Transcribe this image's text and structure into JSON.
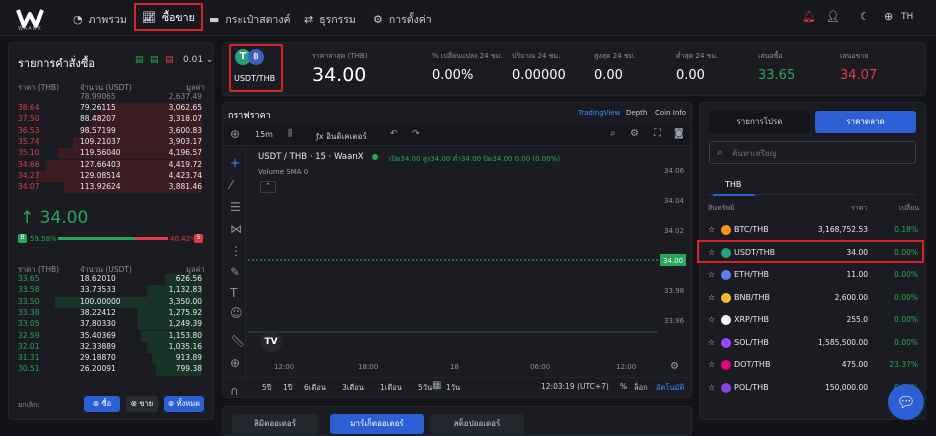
{
  "nav": {
    "logo_text": "WAANX",
    "items": [
      {
        "label": "ภาพรวม",
        "icon": "pie-chart-icon"
      },
      {
        "label": "ซื้อขาย",
        "icon": "trend-chart-icon"
      },
      {
        "label": "กระเป๋าสตางค์",
        "icon": "wallet-icon"
      },
      {
        "label": "ธุรกรรม",
        "icon": "arrows-icon"
      },
      {
        "label": "การตั้งค่า",
        "icon": "gear-icon"
      }
    ],
    "lang": "TH"
  },
  "orderbook": {
    "title": "รายการคำสั่งซื้อ",
    "precision": "0.01",
    "headers": [
      "ราคา (THB)",
      "จำนวน (USDT)",
      "มูลค่า"
    ],
    "partial_top": {
      "price": "",
      "amount": "78.99065",
      "value": "2,637.49"
    },
    "sells": [
      {
        "price": "38.64",
        "amount": "79.26115",
        "value": "3,062.65",
        "depth": 0.55
      },
      {
        "price": "37.50",
        "amount": "88.48207",
        "value": "3,318.07",
        "depth": 0.6
      },
      {
        "price": "36.53",
        "amount": "98.57199",
        "value": "3,600.83",
        "depth": 0.65
      },
      {
        "price": "35.74",
        "amount": "109.21037",
        "value": "3,903.17",
        "depth": 0.7
      },
      {
        "price": "35.10",
        "amount": "119.56040",
        "value": "4,196.57",
        "depth": 0.78
      },
      {
        "price": "34.66",
        "amount": "127.66403",
        "value": "4,419.72",
        "depth": 0.85
      },
      {
        "price": "34.27",
        "amount": "129.08514",
        "value": "4,423.74",
        "depth": 0.9
      },
      {
        "price": "34.07",
        "amount": "113.92624",
        "value": "3,881.46",
        "depth": 0.75
      }
    ],
    "last_price": "↑ 34.00",
    "buy_ratio": "59.58%",
    "sell_ratio": "40.42%",
    "buy_tag": "B",
    "sell_tag": "S",
    "buys": [
      {
        "price": "33.65",
        "amount": "18.62010",
        "value": "626.56",
        "depth": 0.2
      },
      {
        "price": "33.58",
        "amount": "33.73533",
        "value": "1,132.83",
        "depth": 0.3
      },
      {
        "price": "33.50",
        "amount": "100.00000",
        "value": "3,350.00",
        "depth": 0.8
      },
      {
        "price": "33.38",
        "amount": "38.22412",
        "value": "1,275.92",
        "depth": 0.35
      },
      {
        "price": "33.05",
        "amount": "37.80330",
        "value": "1,249.39",
        "depth": 0.35
      },
      {
        "price": "32.59",
        "amount": "35.40369",
        "value": "1,153.80",
        "depth": 0.33
      },
      {
        "price": "32.01",
        "amount": "32.33889",
        "value": "1,035.16",
        "depth": 0.3
      },
      {
        "price": "31.31",
        "amount": "29.18870",
        "value": "913.89",
        "depth": 0.27
      },
      {
        "price": "30.51",
        "amount": "26.20091",
        "value": "799.38",
        "depth": 0.25
      }
    ],
    "cancel_label": "ยกเลิก:",
    "btn_buy": "ซื้อ",
    "btn_sell": "ขาย",
    "btn_all": "ทั้งหมด"
  },
  "pair": {
    "label": "USDT/THB"
  },
  "stats": [
    {
      "label": "ราคาล่าสุด (THB)",
      "value": "34.00"
    },
    {
      "label": "% เปลี่ยนแปลง 24 ชม.",
      "value": "0.00%"
    },
    {
      "label": "ปริมาณ 24 ชม.",
      "value": "0.00000"
    },
    {
      "label": "สูงสุด 24 ชม.",
      "value": "0.00"
    },
    {
      "label": "ต่ำสุด 24 ชม.",
      "value": "0.00"
    },
    {
      "label": "เสนอซื้อ",
      "value": "33.65",
      "color": "#26a65b"
    },
    {
      "label": "เสนอขาย",
      "value": "34.07",
      "color": "#e0394a"
    }
  ],
  "chart": {
    "title": "กราฟราคา",
    "tabs": [
      "TradingView",
      "Depth",
      "Coin Info"
    ],
    "interval": "15m",
    "indicators_label": "อินดิเคเตอร์",
    "symbol": "USDT / THB · 15 · WaanX",
    "ohlc": "เปิด34.00 สูง34.00 ต่ำ34.00 ปิด34.00 0.00 (0.00%)",
    "volume": "Volume SMA 0",
    "y_ticks": [
      "34.06",
      "34.04",
      "34.02",
      "34.00",
      "33.98",
      "33.96"
    ],
    "x_ticks": [
      "12:00",
      "18:00",
      "18",
      "06:00",
      "12:00"
    ],
    "ranges": [
      "5ปี",
      "1ปี",
      "6เดือน",
      "3เดือน",
      "1เดือน",
      "5วัน",
      "1วัน"
    ],
    "time": "12:03:19 (UTC+7)",
    "pct": "%",
    "log": "ล็อก",
    "auto": "อัตโนมัติ",
    "chart_data": {
      "type": "line",
      "series": [
        {
          "values": [
            34.0,
            34.0
          ]
        }
      ],
      "ylim": [
        33.95,
        34.07
      ]
    }
  },
  "market": {
    "tab_orders": "รายการโปรด",
    "tab_market": "ราคาตลาด",
    "search_placeholder": "ค้นหาเหรียญ",
    "currency_tab": "THB",
    "headers": [
      "สินทรัพย์",
      "ราคา",
      "เปลี่ยน"
    ],
    "rows": [
      {
        "symbol": "BTC/THB",
        "price": "3,168,752.53",
        "change": "0.18%",
        "color": "#f7931a"
      },
      {
        "symbol": "USDT/THB",
        "price": "34.00",
        "change": "0.00%",
        "color": "#26a17b"
      },
      {
        "symbol": "ETH/THB",
        "price": "11.00",
        "change": "0.00%",
        "color": "#627eea"
      },
      {
        "symbol": "BNB/THB",
        "price": "2,600.00",
        "change": "0.00%",
        "color": "#f3ba2f"
      },
      {
        "symbol": "XRP/THB",
        "price": "255.0",
        "change": "0.00%",
        "color": "#ffffff"
      },
      {
        "symbol": "SOL/THB",
        "price": "1,585,500.00",
        "change": "0.00%",
        "color": "#9945ff"
      },
      {
        "symbol": "DOT/THB",
        "price": "475.00",
        "change": "23.37%",
        "color": "#e6007a"
      },
      {
        "symbol": "POL/THB",
        "price": "150,000.00",
        "change": "0.00%",
        "color": "#8247e5"
      }
    ]
  },
  "bottom_tabs": [
    "ลิมิตออเดอร์",
    "มาร์เก็ตออเดอร์",
    "สต็อปออเดอร์"
  ]
}
